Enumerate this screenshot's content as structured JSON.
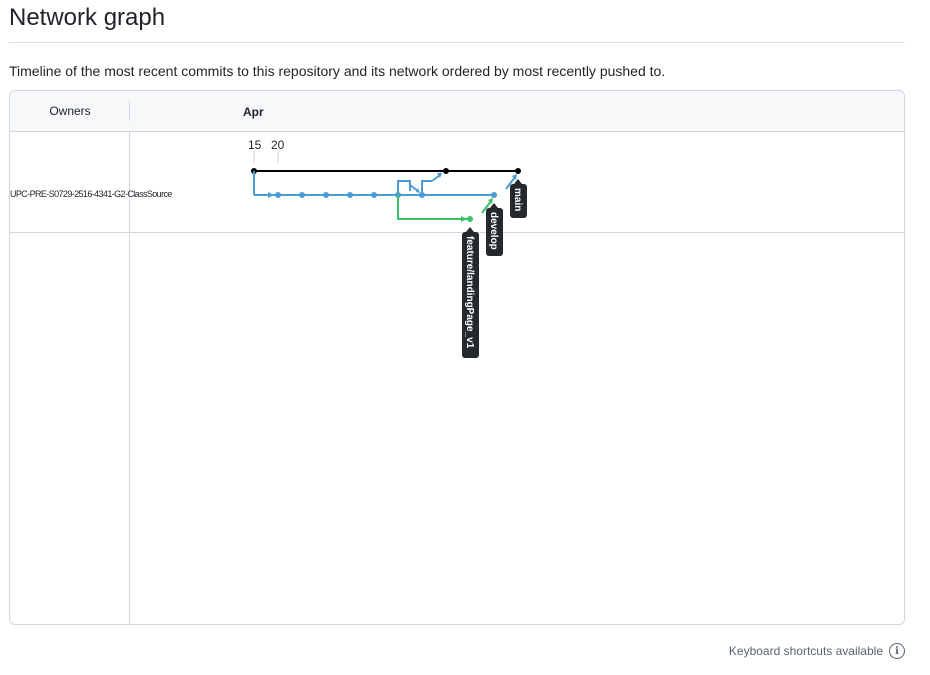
{
  "page": {
    "title": "Network graph",
    "description": "Timeline of the most recent commits to this repository and its network ordered by most recently pushed to."
  },
  "graph": {
    "owners_header": "Owners",
    "owner_name": "UPC-PRE-S0729-2516-4341-G2-ClassSource",
    "month_label": "Apr",
    "day_labels": [
      "15",
      "20"
    ],
    "branches": [
      {
        "name": "main",
        "color": "#000000"
      },
      {
        "name": "develop",
        "color": "#4a9bd3"
      },
      {
        "name": "feature/landingPage_v1",
        "color": "#3cc167"
      }
    ]
  },
  "footer": {
    "shortcuts_text": "Keyboard shortcuts available",
    "icon": "info-icon"
  }
}
